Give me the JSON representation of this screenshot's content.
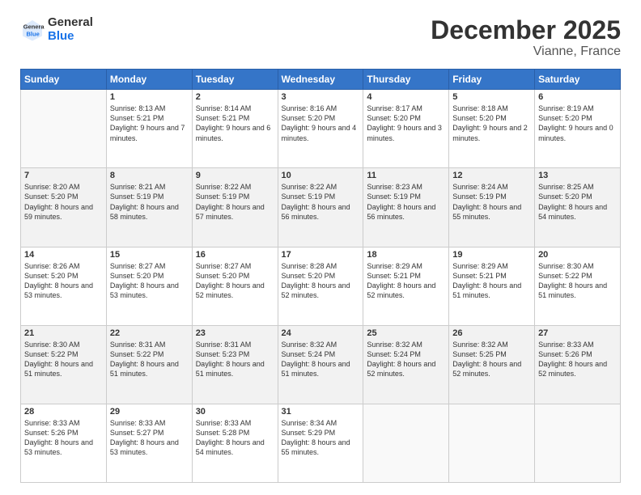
{
  "logo": {
    "line1": "General",
    "line2": "Blue"
  },
  "title": "December 2025",
  "subtitle": "Vianne, France",
  "days_of_week": [
    "Sunday",
    "Monday",
    "Tuesday",
    "Wednesday",
    "Thursday",
    "Friday",
    "Saturday"
  ],
  "weeks": [
    [
      {
        "day": "",
        "sunrise": "",
        "sunset": "",
        "daylight": ""
      },
      {
        "day": "1",
        "sunrise": "Sunrise: 8:13 AM",
        "sunset": "Sunset: 5:21 PM",
        "daylight": "Daylight: 9 hours and 7 minutes."
      },
      {
        "day": "2",
        "sunrise": "Sunrise: 8:14 AM",
        "sunset": "Sunset: 5:21 PM",
        "daylight": "Daylight: 9 hours and 6 minutes."
      },
      {
        "day": "3",
        "sunrise": "Sunrise: 8:16 AM",
        "sunset": "Sunset: 5:20 PM",
        "daylight": "Daylight: 9 hours and 4 minutes."
      },
      {
        "day": "4",
        "sunrise": "Sunrise: 8:17 AM",
        "sunset": "Sunset: 5:20 PM",
        "daylight": "Daylight: 9 hours and 3 minutes."
      },
      {
        "day": "5",
        "sunrise": "Sunrise: 8:18 AM",
        "sunset": "Sunset: 5:20 PM",
        "daylight": "Daylight: 9 hours and 2 minutes."
      },
      {
        "day": "6",
        "sunrise": "Sunrise: 8:19 AM",
        "sunset": "Sunset: 5:20 PM",
        "daylight": "Daylight: 9 hours and 0 minutes."
      }
    ],
    [
      {
        "day": "7",
        "sunrise": "Sunrise: 8:20 AM",
        "sunset": "Sunset: 5:20 PM",
        "daylight": "Daylight: 8 hours and 59 minutes."
      },
      {
        "day": "8",
        "sunrise": "Sunrise: 8:21 AM",
        "sunset": "Sunset: 5:19 PM",
        "daylight": "Daylight: 8 hours and 58 minutes."
      },
      {
        "day": "9",
        "sunrise": "Sunrise: 8:22 AM",
        "sunset": "Sunset: 5:19 PM",
        "daylight": "Daylight: 8 hours and 57 minutes."
      },
      {
        "day": "10",
        "sunrise": "Sunrise: 8:22 AM",
        "sunset": "Sunset: 5:19 PM",
        "daylight": "Daylight: 8 hours and 56 minutes."
      },
      {
        "day": "11",
        "sunrise": "Sunrise: 8:23 AM",
        "sunset": "Sunset: 5:19 PM",
        "daylight": "Daylight: 8 hours and 56 minutes."
      },
      {
        "day": "12",
        "sunrise": "Sunrise: 8:24 AM",
        "sunset": "Sunset: 5:19 PM",
        "daylight": "Daylight: 8 hours and 55 minutes."
      },
      {
        "day": "13",
        "sunrise": "Sunrise: 8:25 AM",
        "sunset": "Sunset: 5:20 PM",
        "daylight": "Daylight: 8 hours and 54 minutes."
      }
    ],
    [
      {
        "day": "14",
        "sunrise": "Sunrise: 8:26 AM",
        "sunset": "Sunset: 5:20 PM",
        "daylight": "Daylight: 8 hours and 53 minutes."
      },
      {
        "day": "15",
        "sunrise": "Sunrise: 8:27 AM",
        "sunset": "Sunset: 5:20 PM",
        "daylight": "Daylight: 8 hours and 53 minutes."
      },
      {
        "day": "16",
        "sunrise": "Sunrise: 8:27 AM",
        "sunset": "Sunset: 5:20 PM",
        "daylight": "Daylight: 8 hours and 52 minutes."
      },
      {
        "day": "17",
        "sunrise": "Sunrise: 8:28 AM",
        "sunset": "Sunset: 5:20 PM",
        "daylight": "Daylight: 8 hours and 52 minutes."
      },
      {
        "day": "18",
        "sunrise": "Sunrise: 8:29 AM",
        "sunset": "Sunset: 5:21 PM",
        "daylight": "Daylight: 8 hours and 52 minutes."
      },
      {
        "day": "19",
        "sunrise": "Sunrise: 8:29 AM",
        "sunset": "Sunset: 5:21 PM",
        "daylight": "Daylight: 8 hours and 51 minutes."
      },
      {
        "day": "20",
        "sunrise": "Sunrise: 8:30 AM",
        "sunset": "Sunset: 5:22 PM",
        "daylight": "Daylight: 8 hours and 51 minutes."
      }
    ],
    [
      {
        "day": "21",
        "sunrise": "Sunrise: 8:30 AM",
        "sunset": "Sunset: 5:22 PM",
        "daylight": "Daylight: 8 hours and 51 minutes."
      },
      {
        "day": "22",
        "sunrise": "Sunrise: 8:31 AM",
        "sunset": "Sunset: 5:22 PM",
        "daylight": "Daylight: 8 hours and 51 minutes."
      },
      {
        "day": "23",
        "sunrise": "Sunrise: 8:31 AM",
        "sunset": "Sunset: 5:23 PM",
        "daylight": "Daylight: 8 hours and 51 minutes."
      },
      {
        "day": "24",
        "sunrise": "Sunrise: 8:32 AM",
        "sunset": "Sunset: 5:24 PM",
        "daylight": "Daylight: 8 hours and 51 minutes."
      },
      {
        "day": "25",
        "sunrise": "Sunrise: 8:32 AM",
        "sunset": "Sunset: 5:24 PM",
        "daylight": "Daylight: 8 hours and 52 minutes."
      },
      {
        "day": "26",
        "sunrise": "Sunrise: 8:32 AM",
        "sunset": "Sunset: 5:25 PM",
        "daylight": "Daylight: 8 hours and 52 minutes."
      },
      {
        "day": "27",
        "sunrise": "Sunrise: 8:33 AM",
        "sunset": "Sunset: 5:26 PM",
        "daylight": "Daylight: 8 hours and 52 minutes."
      }
    ],
    [
      {
        "day": "28",
        "sunrise": "Sunrise: 8:33 AM",
        "sunset": "Sunset: 5:26 PM",
        "daylight": "Daylight: 8 hours and 53 minutes."
      },
      {
        "day": "29",
        "sunrise": "Sunrise: 8:33 AM",
        "sunset": "Sunset: 5:27 PM",
        "daylight": "Daylight: 8 hours and 53 minutes."
      },
      {
        "day": "30",
        "sunrise": "Sunrise: 8:33 AM",
        "sunset": "Sunset: 5:28 PM",
        "daylight": "Daylight: 8 hours and 54 minutes."
      },
      {
        "day": "31",
        "sunrise": "Sunrise: 8:34 AM",
        "sunset": "Sunset: 5:29 PM",
        "daylight": "Daylight: 8 hours and 55 minutes."
      },
      {
        "day": "",
        "sunrise": "",
        "sunset": "",
        "daylight": ""
      },
      {
        "day": "",
        "sunrise": "",
        "sunset": "",
        "daylight": ""
      },
      {
        "day": "",
        "sunrise": "",
        "sunset": "",
        "daylight": ""
      }
    ]
  ]
}
